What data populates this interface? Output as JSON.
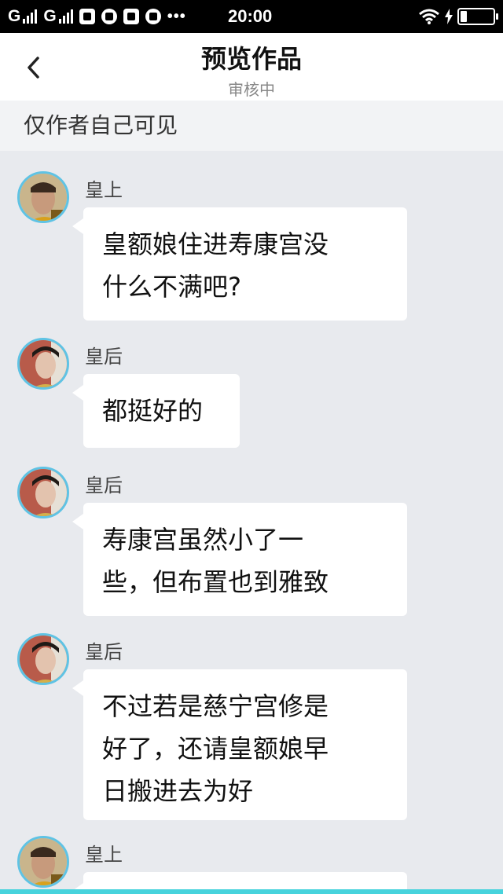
{
  "status_bar": {
    "carrier1": "G",
    "carrier2": "G",
    "more": "•••",
    "time": "20:00"
  },
  "nav": {
    "title": "预览作品",
    "subtitle": "审核中"
  },
  "visibility_notice": "仅作者自己可见",
  "messages": [
    {
      "sender": "皇上",
      "text": "皇额娘住进寿康宫没\n什么不满吧?",
      "avatar": "emperor-avatar"
    },
    {
      "sender": "皇后",
      "text": "都挺好的",
      "avatar": "empress-avatar"
    },
    {
      "sender": "皇后",
      "text": "寿康宫虽然小了一\n些，但布置也到雅致",
      "avatar": "empress-avatar"
    },
    {
      "sender": "皇后",
      "text": "不过若是慈宁宫修是\n好了，还请皇额娘早\n日搬进去为好",
      "avatar": "empress-avatar"
    },
    {
      "sender": "皇上",
      "text": "",
      "avatar": "emperor-avatar"
    }
  ]
}
